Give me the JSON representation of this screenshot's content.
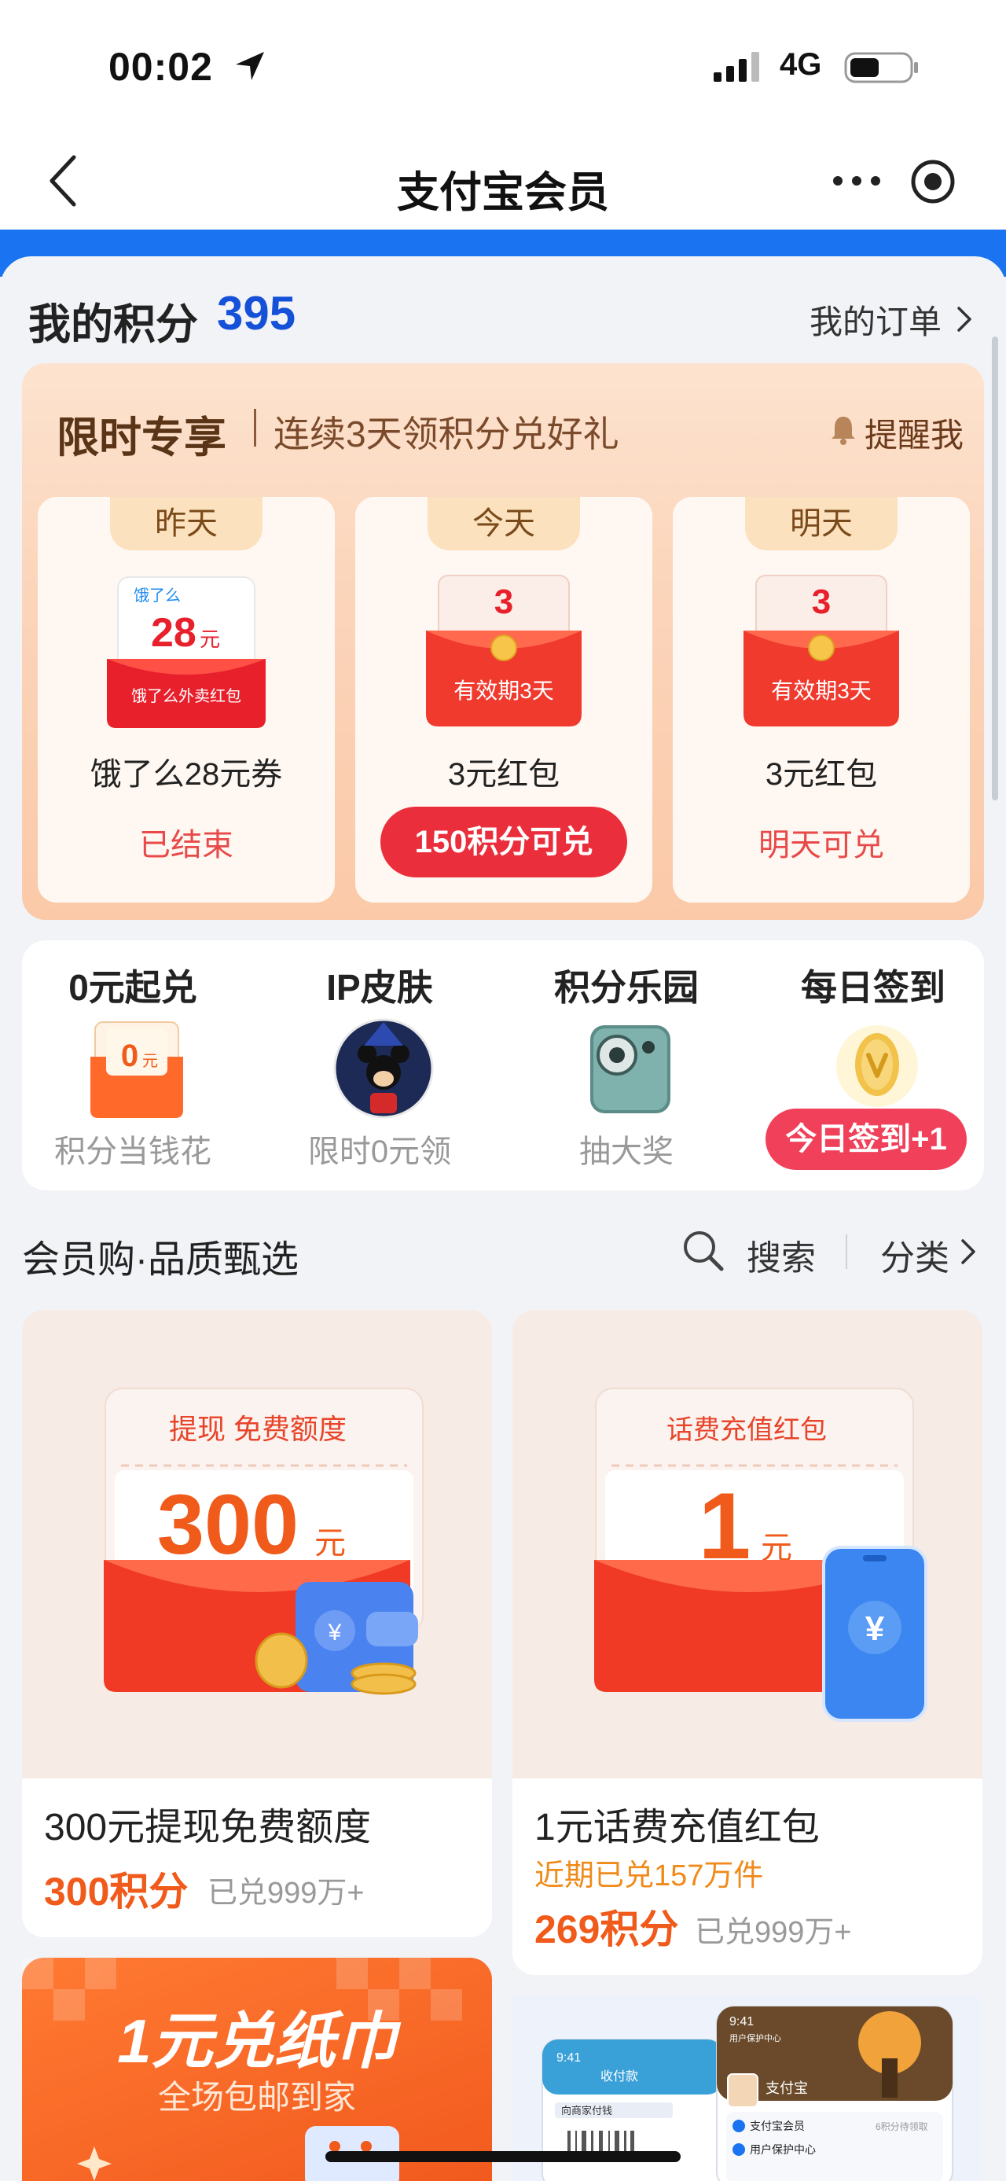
{
  "status_bar": {
    "time": "00:02",
    "network": "4G"
  },
  "nav": {
    "title": "支付宝会员"
  },
  "points": {
    "label": "我的积分",
    "value": "395",
    "orders_label": "我的订单"
  },
  "limited": {
    "title": "限时专享",
    "subtitle": "连续3天领积分兑好礼",
    "remind_label": "提醒我",
    "days": [
      {
        "tab": "昨天",
        "art_brand": "饿了么",
        "art_amount": "28",
        "art_unit": "元",
        "art_label": "饿了么外卖红包",
        "name": "饿了么28元券",
        "status": "已结束"
      },
      {
        "tab": "今天",
        "art_amount": "3",
        "art_label": "有效期3天",
        "name": "3元红包",
        "button": "150积分可兑"
      },
      {
        "tab": "明天",
        "art_amount": "3",
        "art_label": "有效期3天",
        "name": "3元红包",
        "status": "明天可兑"
      }
    ]
  },
  "quick": [
    {
      "title": "0元起兑",
      "art_text": "0元",
      "sub": "积分当钱花"
    },
    {
      "title": "IP皮肤",
      "sub": "限时0元领"
    },
    {
      "title": "积分乐园",
      "sub": "抽大奖"
    },
    {
      "title": "每日签到",
      "button": "今日签到+1"
    }
  ],
  "section": {
    "title": "会员购·品质甄选",
    "search_label": "搜索",
    "category_label": "分类"
  },
  "products": [
    {
      "art_head": "提现 免费额度",
      "art_amount": "300",
      "art_unit": "元",
      "name": "300元提现免费额度",
      "points": "300积分",
      "sold": "已兑999万+"
    },
    {
      "art_head": "话费充值红包",
      "art_amount": "1",
      "art_unit": "元",
      "name": "1元话费充值红包",
      "note": "近期已兑157万件",
      "points": "269积分",
      "sold": "已兑999万+"
    }
  ],
  "promo": {
    "title": "1元兑纸巾",
    "subtitle": "全场包邮到家"
  },
  "preview": {
    "time_a": "9:41",
    "time_b": "9:41",
    "screen_a": "收付款",
    "row_a": "向商家付钱",
    "app_name": "支付宝",
    "row_b1": "支付宝会员",
    "row_b1_extra": "6积分待领取",
    "row_b2": "用户保护中心",
    "header_b": "用户保护中心"
  },
  "colors": {
    "brand_blue": "#1a73f0",
    "points_blue": "#1550d8",
    "accent_red": "#ea2e3c",
    "accent_orange": "#f05a1a"
  }
}
